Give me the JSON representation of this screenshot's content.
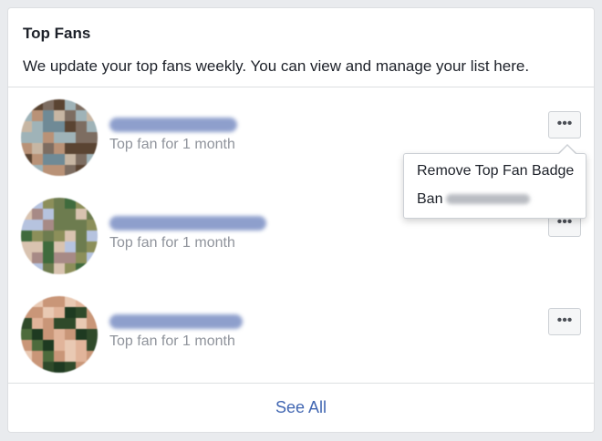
{
  "card": {
    "title": "Top Fans",
    "description": "We update your top fans weekly. You can view and manage your list here."
  },
  "fans": [
    {
      "name_redacted": true,
      "subtitle": "Top fan for 1 month",
      "more_label": "•••",
      "avatar_colors": [
        "#9fb3b8",
        "#6f8a96",
        "#b99277",
        "#5a4432",
        "#c7b6a3",
        "#7d6d61"
      ]
    },
    {
      "name_redacted": true,
      "subtitle": "Top fan for 1 month",
      "more_label": "•••",
      "avatar_colors": [
        "#8c8f5a",
        "#a78a86",
        "#6d7c4f",
        "#b6c3df",
        "#d9c3b0",
        "#3f6b3d"
      ]
    },
    {
      "name_redacted": true,
      "subtitle": "Top fan for 1 month",
      "more_label": "•••",
      "avatar_colors": [
        "#e1b49a",
        "#c99678",
        "#2f4a2a",
        "#4d6b3c",
        "#e9c9b3",
        "#1e3a21"
      ]
    }
  ],
  "menu": {
    "remove_label": "Remove Top Fan Badge",
    "ban_label": "Ban"
  },
  "footer": {
    "see_all_label": "See All"
  },
  "colors": {
    "link": "#4267b2",
    "subtext": "#90949c",
    "text": "#1d2129",
    "redacted_name": "#7b8fc4"
  }
}
